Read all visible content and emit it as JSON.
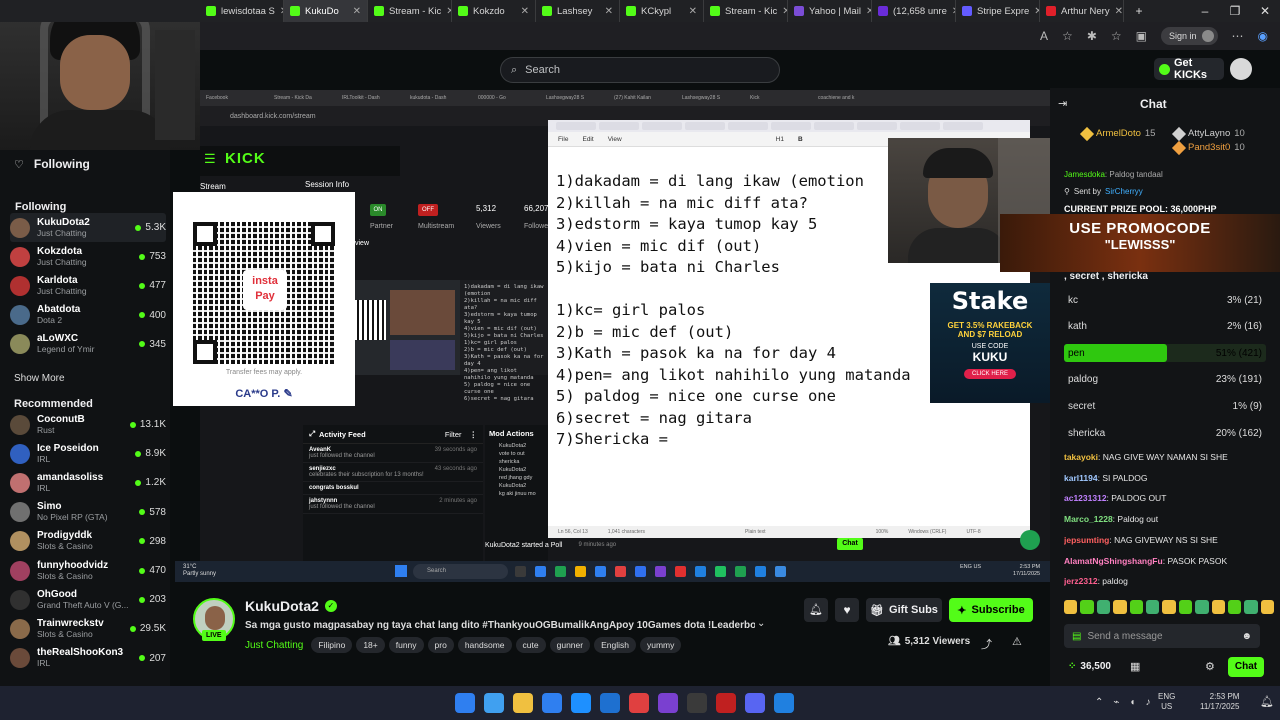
{
  "browser": {
    "tabs": [
      {
        "label": "lewisdotaa S",
        "active": false
      },
      {
        "label": "KukuDo",
        "active": true
      },
      {
        "label": "Stream - Kic",
        "active": false
      },
      {
        "label": "Kokzdo",
        "active": false
      },
      {
        "label": "Lashsey",
        "active": false
      },
      {
        "label": "KCkypl",
        "active": false
      },
      {
        "label": "Stream - Kic",
        "active": false
      },
      {
        "label": "Yahoo | Mail",
        "active": false
      },
      {
        "label": "(12,658 unre",
        "active": false
      },
      {
        "label": "Stripe Expre",
        "active": false
      },
      {
        "label": "Arthur Nery",
        "active": false
      }
    ],
    "signin_label": "Sign in"
  },
  "header": {
    "search_placeholder": "Search",
    "get_kicks_label": "Get KICKs"
  },
  "sidebar": {
    "following_title": "Following",
    "following_label": "Following",
    "following": [
      {
        "name": "KukuDota2",
        "category": "Just Chatting",
        "viewers": "5.3K",
        "color": "#7a5c48"
      },
      {
        "name": "Kokzdota",
        "category": "Just Chatting",
        "viewers": "753",
        "color": "#c04040"
      },
      {
        "name": "Karldota",
        "category": "Just Chatting",
        "viewers": "477",
        "color": "#b03030"
      },
      {
        "name": "Abatdota",
        "category": "Dota 2",
        "viewers": "400",
        "color": "#4a6a8a"
      },
      {
        "name": "aLoWXC",
        "category": "Legend of Ymir",
        "viewers": "345",
        "color": "#8a8a5a"
      }
    ],
    "show_more": "Show More",
    "recommended_label": "Recommended",
    "recommended": [
      {
        "name": "CoconutB",
        "category": "Rust",
        "viewers": "13.1K",
        "color": "#5a4a3a"
      },
      {
        "name": "Ice Poseidon",
        "category": "IRL",
        "viewers": "8.9K",
        "color": "#3060c0"
      },
      {
        "name": "amandasoliss",
        "category": "IRL",
        "viewers": "1.2K",
        "color": "#c07070"
      },
      {
        "name": "Simo",
        "category": "No Pixel RP (GTA)",
        "viewers": "578",
        "color": "#707070"
      },
      {
        "name": "Prodigyddk",
        "category": "Slots & Casino",
        "viewers": "298",
        "color": "#b09060"
      },
      {
        "name": "funnyhoodvidz",
        "category": "Slots & Casino",
        "viewers": "470",
        "color": "#a04060"
      },
      {
        "name": "OhGood",
        "category": "Grand Theft Auto V (G...",
        "viewers": "203",
        "color": "#303030"
      },
      {
        "name": "Trainwreckstv",
        "category": "Slots & Casino",
        "viewers": "29.5K",
        "color": "#8a6a4a"
      },
      {
        "name": "theRealShooKon3",
        "category": "IRL",
        "viewers": "207",
        "color": "#6a4a3a"
      }
    ]
  },
  "stream_overlay": {
    "inner_tabs": [
      "Facebook",
      "Stream - Kick Da",
      "IRLToolkit - Dash",
      "kukudota - Dash",
      "000000 - Go",
      "Lashsegway28 S",
      "(27) Kahit Kailan",
      "Lashsegway28 S",
      "Kick",
      "coachiene and k"
    ],
    "dashboard_url": "dashboard.kick.com/stream",
    "kick_logo": "KICK",
    "stream_label": "Stream",
    "session_info": "Session Info",
    "on_label": "ON",
    "off_label": "OFF",
    "partner_label": "Partner",
    "multistream_label": "Multistream",
    "viewers_count": "5,312",
    "viewers_label": "Viewers",
    "followers_count": "66,207",
    "followers_label": "Followers",
    "view_label": "view",
    "insta_pay": "insta Pay",
    "transfer_fees": "Transfer fees may apply.",
    "qr_name": "CA**O P.",
    "activity_feed": "Activity Feed",
    "filter_label": "Filter",
    "mod_actions": "Mod Actions",
    "activity": [
      {
        "user": "AveanK",
        "desc": "just followed the channel",
        "time": "39 seconds ago"
      },
      {
        "user": "senjiezxc",
        "desc": "celebrates their subscription for 13 months!",
        "time": "43 seconds ago"
      },
      {
        "user": "congrats bosskul",
        "desc": "",
        "time": ""
      },
      {
        "user": "jahstynnn",
        "desc": "just followed the channel",
        "time": "2 minutes ago"
      }
    ],
    "mod_items": [
      "KukuDota2",
      "vote to out",
      "shericka",
      "KukuDota2",
      "red jhang gdy",
      "KukuDota2",
      "kg aki jinuu mo"
    ],
    "started_poll": "KukuDota2 started a Poll",
    "poll_time": "9 minutes ago",
    "chat_button": "Chat",
    "notepad": {
      "menu": [
        "File",
        "Edit",
        "View"
      ],
      "h1": "H1",
      "lines": [
        "1)dakadam = di lang ikaw (emotion",
        "2)killah = na mic diff ata?",
        "3)edstorm = kaya tumop kay 5",
        "4)vien = mic dif (out)",
        "5)kijo = bata ni Charles",
        "",
        "1)kc= girl palos",
        "2)b = mic def (out)",
        "3)Kath = pasok ka na for day 4",
        "4)pen= ang likot nahihilo yung matanda",
        "5) paldog = nice one curse one",
        "6)secret = nag gitara",
        "7)Shericka ="
      ],
      "status": "Ln 56, Col 13",
      "chars": "1,041 characters",
      "plain": "Plain text",
      "zoom": "100%",
      "eol": "Windows (CRLF)",
      "enc": "UTF-8"
    },
    "stake": {
      "logo": "Stake",
      "line1": "GET 3.5% RAKEBACK",
      "line2": "AND $7 RELOAD",
      "use_code": "USE CODE",
      "code": "KUKU",
      "cta": "CLICK HERE"
    },
    "temp": "31°C",
    "weather": "Partly sunny",
    "taskbar_search": "Search",
    "time": "2:53 PM",
    "date": "17/11/2025",
    "lang": "ENG US"
  },
  "channel": {
    "name": "KukuDota2",
    "live_label": "LIVE",
    "title": "Sa mga gusto magpasabay ng taya chat lang dito #ThankyouOGBumalikAngApoy 10Games dota  !Leaderboar...",
    "category": "Just Chatting",
    "tags": [
      "Filipino",
      "18+",
      "funny",
      "pro",
      "handsome",
      "cute",
      "gunner",
      "English",
      "yummy"
    ],
    "gift_subs": "Gift Subs",
    "subscribe": "Subscribe",
    "viewers": "5,312 Viewers"
  },
  "chat": {
    "title": "Chat",
    "leaderboard": [
      {
        "name": "ArmelDoto",
        "score": "15",
        "color": "#f0c040"
      },
      {
        "name": "AttyLayno",
        "score": "10",
        "color": "#d0d0d0"
      },
      {
        "name": "Pand3sit0",
        "score": "10",
        "color": "#f0a040"
      }
    ],
    "pinned_user": "Jamesdoka",
    "pinned_msg": "Paldog tandaal",
    "sent_by_label": "Sent by",
    "sent_by_user": "SirCherryy",
    "prize_pool": "CURRENT PRIZE POOL: 36,000PHP",
    "promo1": "USE PROMOCODE",
    "promo2": "\"LEWISSS\"",
    "poll_header": ", secret , shericka",
    "poll": [
      {
        "label": "kc",
        "value": "3% (21)",
        "pct": 3
      },
      {
        "label": "kath",
        "value": "2% (16)",
        "pct": 2
      },
      {
        "label": "pen",
        "value": "51% (421)",
        "pct": 51
      },
      {
        "label": "paldog",
        "value": "23% (191)",
        "pct": 23
      },
      {
        "label": "secret",
        "value": "1% (9)",
        "pct": 1
      },
      {
        "label": "shericka",
        "value": "20% (162)",
        "pct": 20
      }
    ],
    "messages": [
      {
        "user": "takayoki",
        "text": "NAG GIVE WAY NAMAN SI SHE",
        "color": "#f0c040"
      },
      {
        "user": "karl1194",
        "text": "SI PALDOG",
        "color": "#a0c8ff"
      },
      {
        "user": "ac1231312",
        "text": "PALDOG OUT",
        "color": "#c080ff"
      },
      {
        "user": "Marco_1228",
        "text": "Paldog out",
        "color": "#80e080"
      },
      {
        "user": "jepsumting",
        "text": "NAG GIVEWAY NS SI SHE",
        "color": "#ff6060"
      },
      {
        "user": "AlamatNgShingshangFu",
        "text": "PASOK PASOK",
        "color": "#ff80c0"
      },
      {
        "user": "jerz2312",
        "text": "paldog",
        "color": "#ff6090"
      }
    ],
    "input_placeholder": "Send a message",
    "kicks_balance": "36,500",
    "chat_button": "Chat"
  },
  "taskbar": {
    "lang": "ENG",
    "region": "US",
    "time": "2:53 PM",
    "date": "11/17/2025"
  }
}
